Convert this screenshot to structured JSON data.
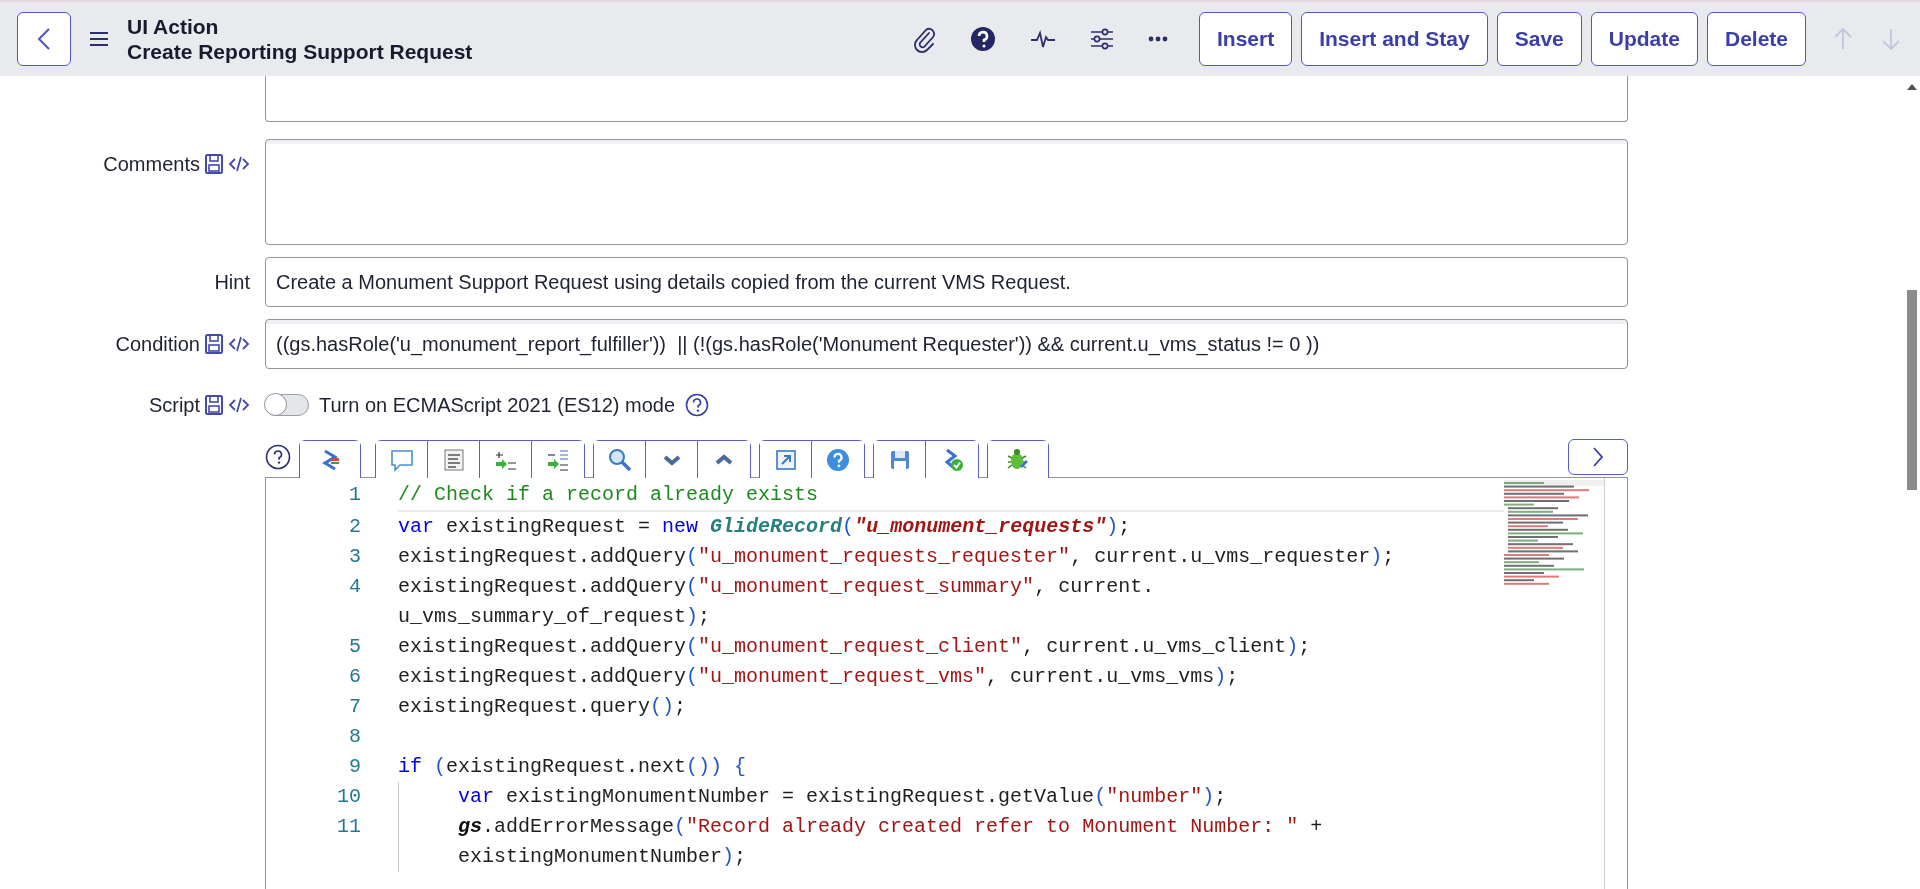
{
  "header": {
    "title": "UI Action",
    "subtitle": "Create Reporting Support Request",
    "buttons": [
      "Insert",
      "Insert and Stay",
      "Save",
      "Update",
      "Delete"
    ],
    "nav_buttons": [
      {
        "kind": "up",
        "disabled": true
      },
      {
        "kind": "down",
        "disabled": true
      }
    ]
  },
  "fields": [
    {
      "kind": "textarea_partial"
    },
    {
      "kind": "textarea",
      "label": "Comments",
      "icons": true
    },
    {
      "kind": "text",
      "label": "Hint",
      "value": "Create a Monument Support Request using details copied from the current VMS Request."
    },
    {
      "kind": "text",
      "label": "Condition",
      "icons": true,
      "value": "((gs.hasRole('u_monument_report_fulfiller'))  || (!(gs.hasRole('Monument Requester')) && current.u_vms_status != 0 ))"
    }
  ],
  "script": {
    "label": "Script",
    "icons": true,
    "toggle": {
      "label": "Turn on ECMAScript 2021 (ES12) mode",
      "on": false
    },
    "lines": [
      {
        "number": "1",
        "active": true,
        "parts": [
          {
            "segments": [
              {
                "kind": "comment",
                "text": "// Check if a record already exists"
              }
            ]
          }
        ]
      },
      {
        "number": "2",
        "active": false,
        "parts": [
          {
            "segments": [
              {
                "kind": "keyword",
                "text": "var"
              },
              {
                "kind": "plain",
                "text": " existingRequest = "
              },
              {
                "kind": "keyword",
                "text": "new "
              },
              {
                "kind": "class",
                "text": "GlideRecord"
              },
              {
                "kind": "paren",
                "text": "("
              },
              {
                "kind": "strong_string",
                "text": "\"u_monument_requests\""
              },
              {
                "kind": "paren",
                "text": ")"
              },
              {
                "kind": "plain",
                "text": ";"
              }
            ]
          }
        ]
      },
      {
        "number": "3",
        "active": false,
        "parts": [
          {
            "segments": [
              {
                "kind": "plain",
                "text": "existingRequest.addQuery"
              },
              {
                "kind": "paren",
                "text": "("
              },
              {
                "kind": "string",
                "text": "\"u_monument_requests_requester\""
              },
              {
                "kind": "plain",
                "text": ", current.u_vms_requester"
              },
              {
                "kind": "paren",
                "text": ")"
              },
              {
                "kind": "plain",
                "text": ";"
              }
            ]
          }
        ]
      },
      {
        "number": "4",
        "active": false,
        "parts": [
          {
            "segments": [
              {
                "kind": "plain",
                "text": "existingRequest.addQuery"
              },
              {
                "kind": "paren",
                "text": "("
              },
              {
                "kind": "string",
                "text": "\"u_monument_request_summary\""
              },
              {
                "kind": "plain",
                "text": ", current."
              }
            ]
          },
          {
            "segments": [
              {
                "kind": "plain",
                "text": "u_vms_summary_of_request"
              },
              {
                "kind": "paren",
                "text": ")"
              },
              {
                "kind": "plain",
                "text": ";"
              }
            ]
          }
        ]
      },
      {
        "number": "5",
        "active": false,
        "parts": [
          {
            "segments": [
              {
                "kind": "plain",
                "text": "existingRequest.addQuery"
              },
              {
                "kind": "paren",
                "text": "("
              },
              {
                "kind": "string",
                "text": "\"u_monument_request_client\""
              },
              {
                "kind": "plain",
                "text": ", current.u_vms_client"
              },
              {
                "kind": "paren",
                "text": ")"
              },
              {
                "kind": "plain",
                "text": ";"
              }
            ]
          }
        ]
      },
      {
        "number": "6",
        "active": false,
        "parts": [
          {
            "segments": [
              {
                "kind": "plain",
                "text": "existingRequest.addQuery"
              },
              {
                "kind": "paren",
                "text": "("
              },
              {
                "kind": "string",
                "text": "\"u_monument_request_vms\""
              },
              {
                "kind": "plain",
                "text": ", current.u_vms_vms"
              },
              {
                "kind": "paren",
                "text": ")"
              },
              {
                "kind": "plain",
                "text": ";"
              }
            ]
          }
        ]
      },
      {
        "number": "7",
        "active": false,
        "parts": [
          {
            "segments": [
              {
                "kind": "plain",
                "text": "existingRequest.query"
              },
              {
                "kind": "paren",
                "text": "()"
              },
              {
                "kind": "plain",
                "text": ";"
              }
            ]
          }
        ]
      },
      {
        "number": "8",
        "active": false
      },
      {
        "number": "9",
        "active": false,
        "parts": [
          {
            "segments": [
              {
                "kind": "keyword",
                "text": "if "
              },
              {
                "kind": "paren",
                "text": "("
              },
              {
                "kind": "plain",
                "text": "existingRequest.next"
              },
              {
                "kind": "paren",
                "text": "()) {"
              }
            ]
          }
        ]
      },
      {
        "number": "10",
        "active": false,
        "indented": true,
        "parts": [
          {
            "segments": [
              {
                "kind": "keyword",
                "text": "var"
              },
              {
                "kind": "plain",
                "text": " existingMonumentNumber = existingRequest.getValue"
              },
              {
                "kind": "paren",
                "text": "("
              },
              {
                "kind": "string",
                "text": "\"number\""
              },
              {
                "kind": "paren",
                "text": ")"
              },
              {
                "kind": "plain",
                "text": ";"
              }
            ]
          }
        ]
      },
      {
        "number": "11",
        "active": false,
        "indented": true,
        "parts": [
          {
            "segments": [
              {
                "kind": "global",
                "text": "gs"
              },
              {
                "kind": "plain",
                "text": ".addErrorMessage"
              },
              {
                "kind": "paren",
                "text": "("
              },
              {
                "kind": "string",
                "text": "\"Record already created refer to Monument Number: \""
              },
              {
                "kind": "plain",
                "text": " +"
              }
            ]
          },
          {
            "segments": [
              {
                "kind": "plain",
                "text": "existingMonumentNumber"
              },
              {
                "kind": "paren",
                "text": ")"
              },
              {
                "kind": "plain",
                "text": ";"
              }
            ]
          }
        ]
      }
    ]
  }
}
